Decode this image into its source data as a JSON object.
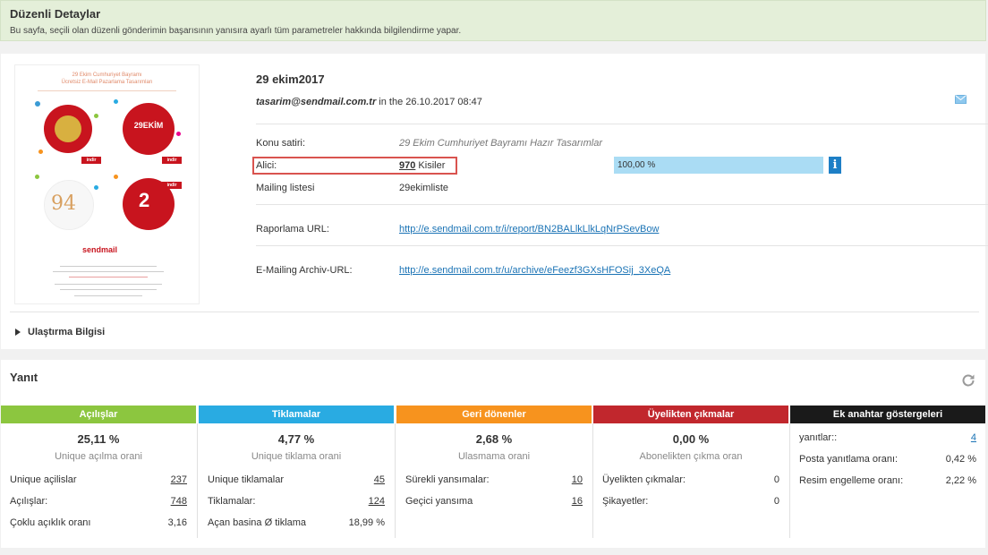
{
  "header": {
    "title": "Düzenli Detaylar",
    "subtitle": "Bu sayfa, seçili olan düzenli gönderimin başarısının yanısıra ayarlı tüm parametreler hakkında bilgilendirme yapar."
  },
  "thumbnail": {
    "heading_line1": "29 Ekim Cumhuriyet Bayramı",
    "heading_line2": "Ücretsiz E-Mail Pazarlama Tasarımları",
    "tile_text_29ekim": "29EKİM",
    "indir_label": "indir",
    "logo": "sendmail",
    "big_94": "94",
    "big_25": "2"
  },
  "mailing": {
    "title": "29 ekim2017",
    "sender": "tasarim@sendmail.com.tr",
    "in_the": "in the",
    "date": "26.10.2017 08:47",
    "subject_label": "Konu satiri:",
    "subject_value": "29 Ekim Cumhuriyet Bayramı Hazır Tasarımlar",
    "recipient_label": "Alici:",
    "recipient_count": "970",
    "recipient_unit": "Kisiler",
    "recipient_percent": "100,00 %",
    "recipient_fill": 1.0,
    "list_label": "Mailing listesi",
    "list_value": "29ekimliste",
    "report_url_label": "Raporlama URL:",
    "report_url": "http://e.sendmail.com.tr/i/report/BN2BALlkLlkLqNrPSevBow",
    "archive_url_label": "E-Mailing Archiv-URL:",
    "archive_url": "http://e.sendmail.com.tr/u/archive/eFeezf3GXsHFOSij_3XeQA",
    "delivery_toggle": "Ulaştırma Bilgisi"
  },
  "response": {
    "title": "Yanıt",
    "columns": [
      {
        "header": "Açılışlar",
        "color": "#8cc63f",
        "percent": "25,11 %",
        "sublabel": "Unique açılma orani",
        "rows": [
          {
            "k": "Unique açilislar",
            "v": "237"
          },
          {
            "k": "Açılışlar:",
            "v": "748"
          },
          {
            "k": "Çoklu açıklık oranı",
            "v": "3,16"
          }
        ]
      },
      {
        "header": "Tiklamalar",
        "color": "#29abe2",
        "percent": "4,77 %",
        "sublabel": "Unique tiklama orani",
        "rows": [
          {
            "k": "Unique tiklamalar",
            "v": "45"
          },
          {
            "k": "Tiklamalar:",
            "v": "124"
          },
          {
            "k": "Açan basina Ø tiklama",
            "v": "18,99 %"
          }
        ]
      },
      {
        "header": "Geri dönenler",
        "color": "#f7931e",
        "percent": "2,68 %",
        "sublabel": "Ulasmama orani",
        "rows": [
          {
            "k": "Sürekli yansımalar:",
            "v": "10"
          },
          {
            "k": "Geçici yansıma",
            "v": "16"
          }
        ]
      },
      {
        "header": "Üyelikten çıkmalar",
        "color": "#c1272d",
        "percent": "0,00 %",
        "sublabel": "Abonelikten çıkma oran",
        "rows": [
          {
            "k": "Üyelikten çıkmalar:",
            "v": "0"
          },
          {
            "k": "Şikayetler:",
            "v": "0"
          }
        ]
      },
      {
        "header": "Ek anahtar göstergeleri",
        "color": "#1a1a1a",
        "rows": [
          {
            "k": "yanıtlar::",
            "v": "4"
          },
          {
            "k": "Posta yanıtlama oranı:",
            "v": "0,42 %"
          },
          {
            "k": "Resim engelleme oranı:",
            "v": "2,22 %"
          }
        ]
      }
    ]
  }
}
